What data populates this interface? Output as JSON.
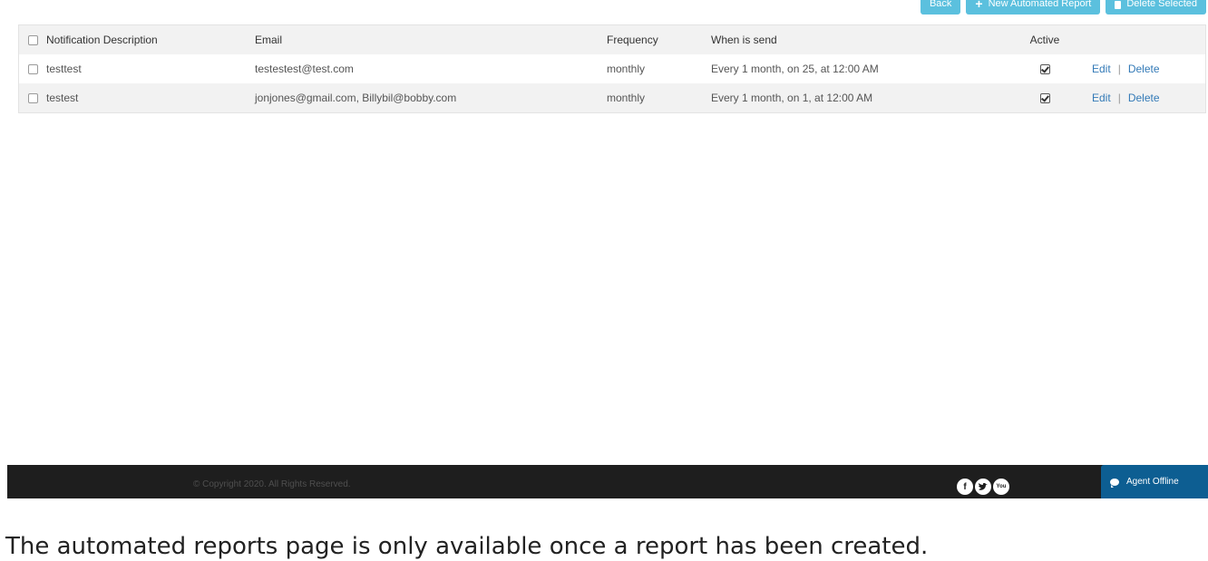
{
  "toolbar": {
    "back_label": "Back",
    "new_report_label": "New Automated Report",
    "delete_selected_label": "Delete Selected"
  },
  "table": {
    "headers": {
      "description": "Notification Description",
      "email": "Email",
      "frequency": "Frequency",
      "when": "When is send",
      "active": "Active"
    },
    "rows": [
      {
        "description": "testtest",
        "email": "testestest@test.com",
        "frequency": "monthly",
        "when": "Every 1 month, on 25, at 12:00 AM",
        "active": true,
        "edit_label": "Edit",
        "separator": "|",
        "delete_label": "Delete"
      },
      {
        "description": "testest",
        "email": "jonjones@gmail.com, Billybil@bobby.com",
        "frequency": "monthly",
        "when": "Every 1 month, on 1, at 12:00 AM",
        "active": true,
        "edit_label": "Edit",
        "separator": "|",
        "delete_label": "Delete"
      }
    ]
  },
  "footer": {
    "copyright": "© Copyright 2020. All Rights Reserved.",
    "social": [
      {
        "icon": "facebook-icon",
        "glyph": "f"
      },
      {
        "icon": "twitter-icon",
        "glyph": "t"
      },
      {
        "icon": "youtube-icon",
        "glyph": "You"
      }
    ],
    "agent_status": "Agent Offline"
  },
  "caption": "The automated reports page is only available once a report has been created.",
  "colors": {
    "button_bg": "#5bc0de",
    "link": "#337ab7",
    "footer_bg": "#1e1e1e",
    "agent_bg": "#0d5e92"
  }
}
